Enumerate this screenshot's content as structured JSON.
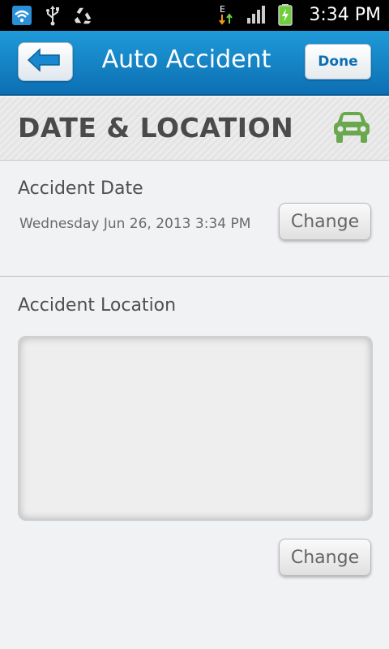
{
  "status_bar": {
    "time": "3:34 PM",
    "icons": [
      "wifi-icon",
      "usb-icon",
      "recycle-icon",
      "edge-data-icon",
      "signal-icon",
      "battery-charging-icon"
    ]
  },
  "header": {
    "title": "Auto Accident",
    "back_icon": "arrow-left-icon",
    "done_label": "Done"
  },
  "section": {
    "title": "DATE & LOCATION",
    "icon": "car-icon",
    "icon_color": "#6aa84f"
  },
  "accident_date": {
    "label": "Accident Date",
    "value": "Wednesday Jun 26, 2013 3:34 PM",
    "change_label": "Change"
  },
  "accident_location": {
    "label": "Accident Location",
    "change_label": "Change"
  },
  "colors": {
    "header_blue": "#0c6fb3",
    "background": "#f1f2f3"
  }
}
